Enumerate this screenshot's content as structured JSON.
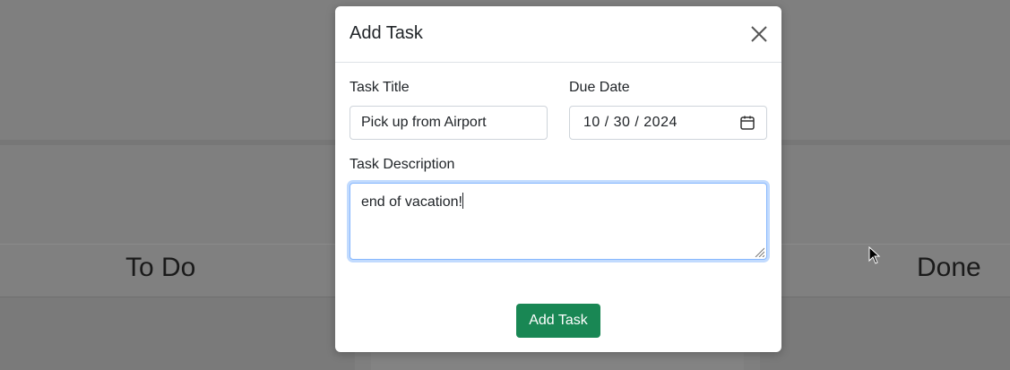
{
  "board": {
    "lanes": [
      {
        "title": "To Do"
      },
      {
        "title": "Done"
      }
    ]
  },
  "modal": {
    "title": "Add Task",
    "close_icon": "close-icon",
    "fields": {
      "title": {
        "label": "Task Title",
        "value": "Pick up from Airport"
      },
      "due_date": {
        "label": "Due Date",
        "value": "10 / 30 / 2024",
        "icon": "calendar-icon"
      },
      "description": {
        "label": "Task Description",
        "value": "end of vacation!"
      }
    },
    "submit_label": "Add Task",
    "submit_color": "#198754"
  },
  "colors": {
    "overlay": "#7f7f7f",
    "focus_border": "#86b7fe"
  }
}
